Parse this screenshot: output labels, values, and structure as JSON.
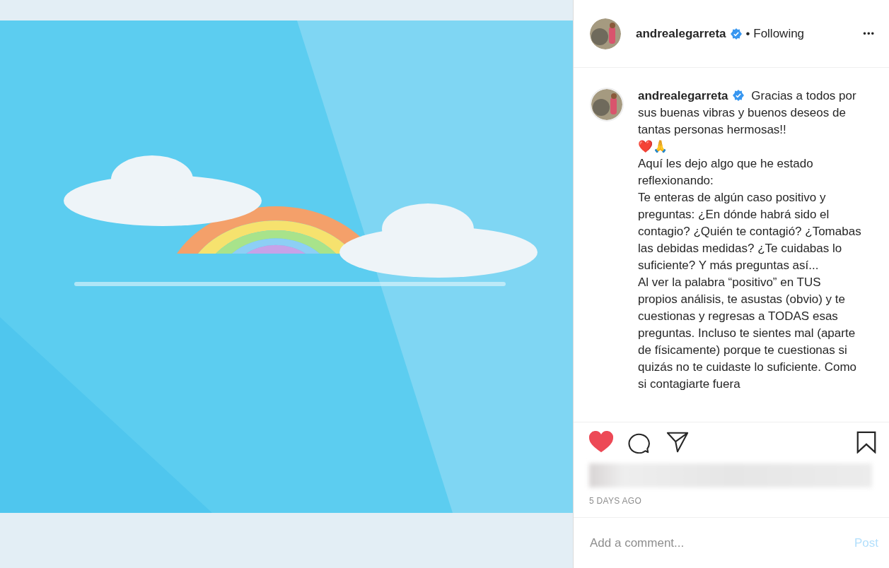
{
  "post": {
    "header": {
      "username": "andrealegarreta",
      "verified": true,
      "follow_status": "• Following",
      "menu": "•••"
    },
    "caption": {
      "username": "andrealegarreta",
      "verified": true,
      "text": "Gracias a todos por sus buenas vibras y buenos deseos de tantas personas hermosas!!\n❤️🙏\nAquí les dejo algo que he estado reflexionando:\nTe enteras de algún caso positivo y preguntas: ¿En dónde habrá sido el contagio? ¿Quién te contagió? ¿Tomabas las debidas medidas? ¿Te cuidabas lo suficiente? Y más preguntas así...\nAl ver la palabra “positivo” en TUS propios análisis, te asustas (obvio) y te cuestionas y regresas a TODAS esas preguntas. Incluso te sientes mal (aparte de físicamente) porque te cuestionas si quizás no te cuidaste lo suficiente. Como si contagiarte fuera"
    },
    "actions": {
      "liked": true,
      "saved": false
    },
    "timestamp": "5 DAYS AGO",
    "comment": {
      "placeholder": "Add a comment...",
      "post_button": "Post"
    }
  }
}
